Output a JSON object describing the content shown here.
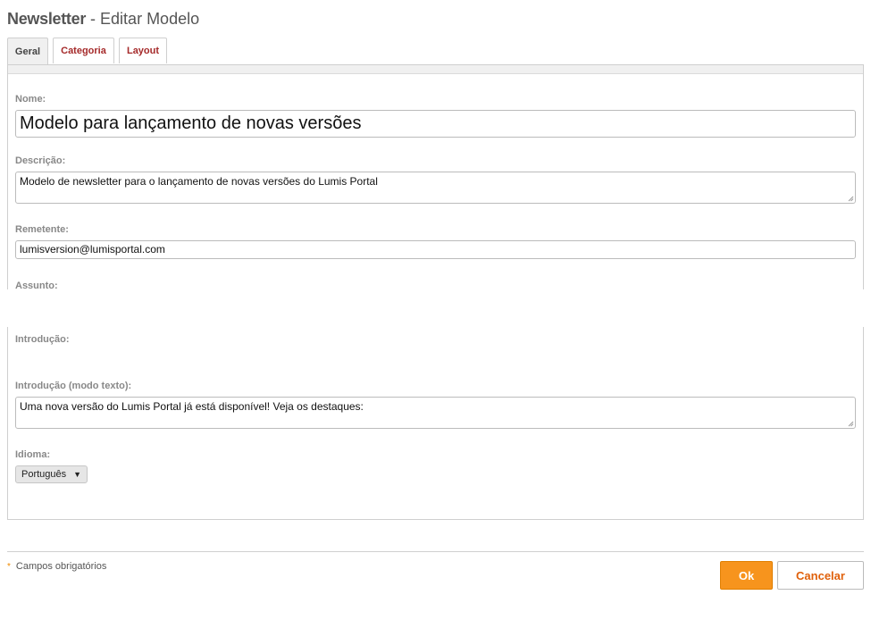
{
  "header": {
    "app_name": "Newsletter",
    "subtitle": " - Editar Modelo"
  },
  "tabs": [
    {
      "label": "Geral",
      "active": true
    },
    {
      "label": "Categoria",
      "active": false
    },
    {
      "label": "Layout",
      "active": false
    }
  ],
  "form": {
    "nome": {
      "label": "Nome:",
      "value": "Modelo para lançamento de novas versões"
    },
    "descricao": {
      "label": "Descrição:",
      "value": "Modelo de newsletter para o lançamento de novas versões do Lumis Portal"
    },
    "remetente": {
      "label": "Remetente:",
      "value": "lumisversion@lumisportal.com"
    },
    "assunto": {
      "label": "Assunto:"
    },
    "introducao": {
      "label": "Introdução:"
    },
    "introducao_texto": {
      "label": "Introdução (modo texto):",
      "value": "Uma nova versão do Lumis Portal já está disponível! Veja os destaques:"
    },
    "idioma": {
      "label": "Idioma:",
      "value": "Português"
    }
  },
  "footer": {
    "required_star": "*",
    "required_note": "Campos obrigatórios",
    "ok_label": "Ok",
    "cancel_label": "Cancelar"
  },
  "colors": {
    "accent": "#f7941d",
    "tab_text": "#a52a2a"
  }
}
